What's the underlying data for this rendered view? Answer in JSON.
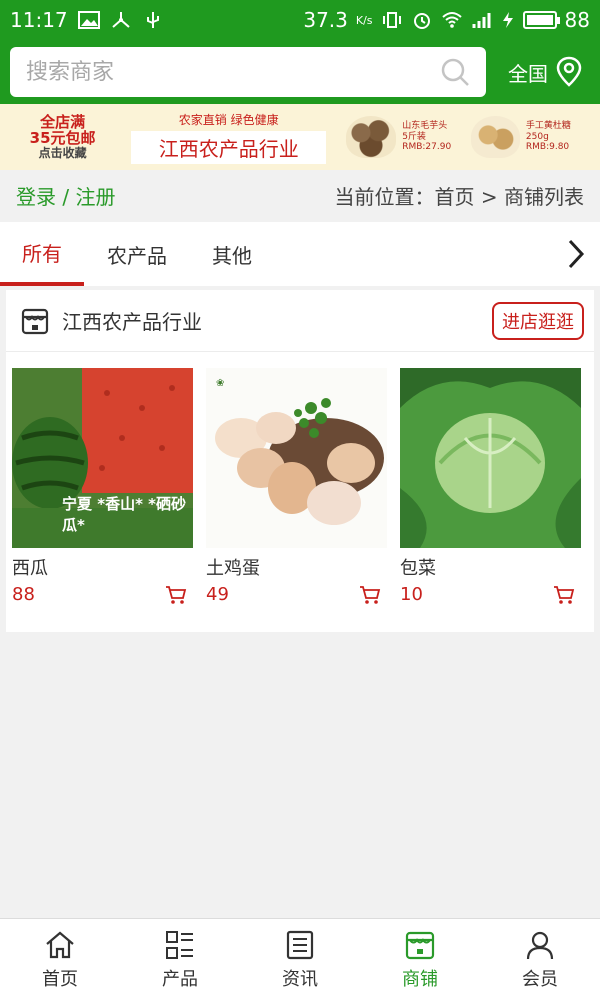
{
  "status": {
    "time": "11:17",
    "speed": "37.3",
    "speed_unit": "K/s",
    "battery": "88"
  },
  "search": {
    "placeholder": "搜索商家"
  },
  "region": {
    "label": "全国"
  },
  "banner": {
    "promo_line1": "全店满",
    "promo_line2": "35元包邮",
    "promo_line3": "点击收藏",
    "slogan": "农家直销 绿色健康",
    "title": "江西农产品行业",
    "product1_name": "山东毛芋头",
    "product1_spec": "5斤装",
    "product1_price": "RMB:27.90",
    "product2_name": "手工黄杜糖250g",
    "product2_price": "RMB:9.80"
  },
  "locbar": {
    "login": "登录 / 注册",
    "location": "当前位置：首页 > 商铺列表"
  },
  "tabs": [
    {
      "label": "所有"
    },
    {
      "label": "农产品"
    },
    {
      "label": "其他"
    }
  ],
  "shop": {
    "name": "江西农产品行业",
    "visit_label": "进店逛逛",
    "products": [
      {
        "name": "西瓜",
        "price": "88",
        "caption": "宁夏 *香山* *硒砂瓜*"
      },
      {
        "name": "土鸡蛋",
        "price": "49"
      },
      {
        "name": "包菜",
        "price": "10"
      }
    ]
  },
  "nav": [
    {
      "label": "首页",
      "icon": "home-icon"
    },
    {
      "label": "产品",
      "icon": "product-grid-icon"
    },
    {
      "label": "资讯",
      "icon": "news-icon"
    },
    {
      "label": "商铺",
      "icon": "shop-icon"
    },
    {
      "label": "会员",
      "icon": "member-icon"
    }
  ],
  "colors": {
    "brand_green": "#1f9a1f",
    "accent_red": "#c8201c"
  }
}
